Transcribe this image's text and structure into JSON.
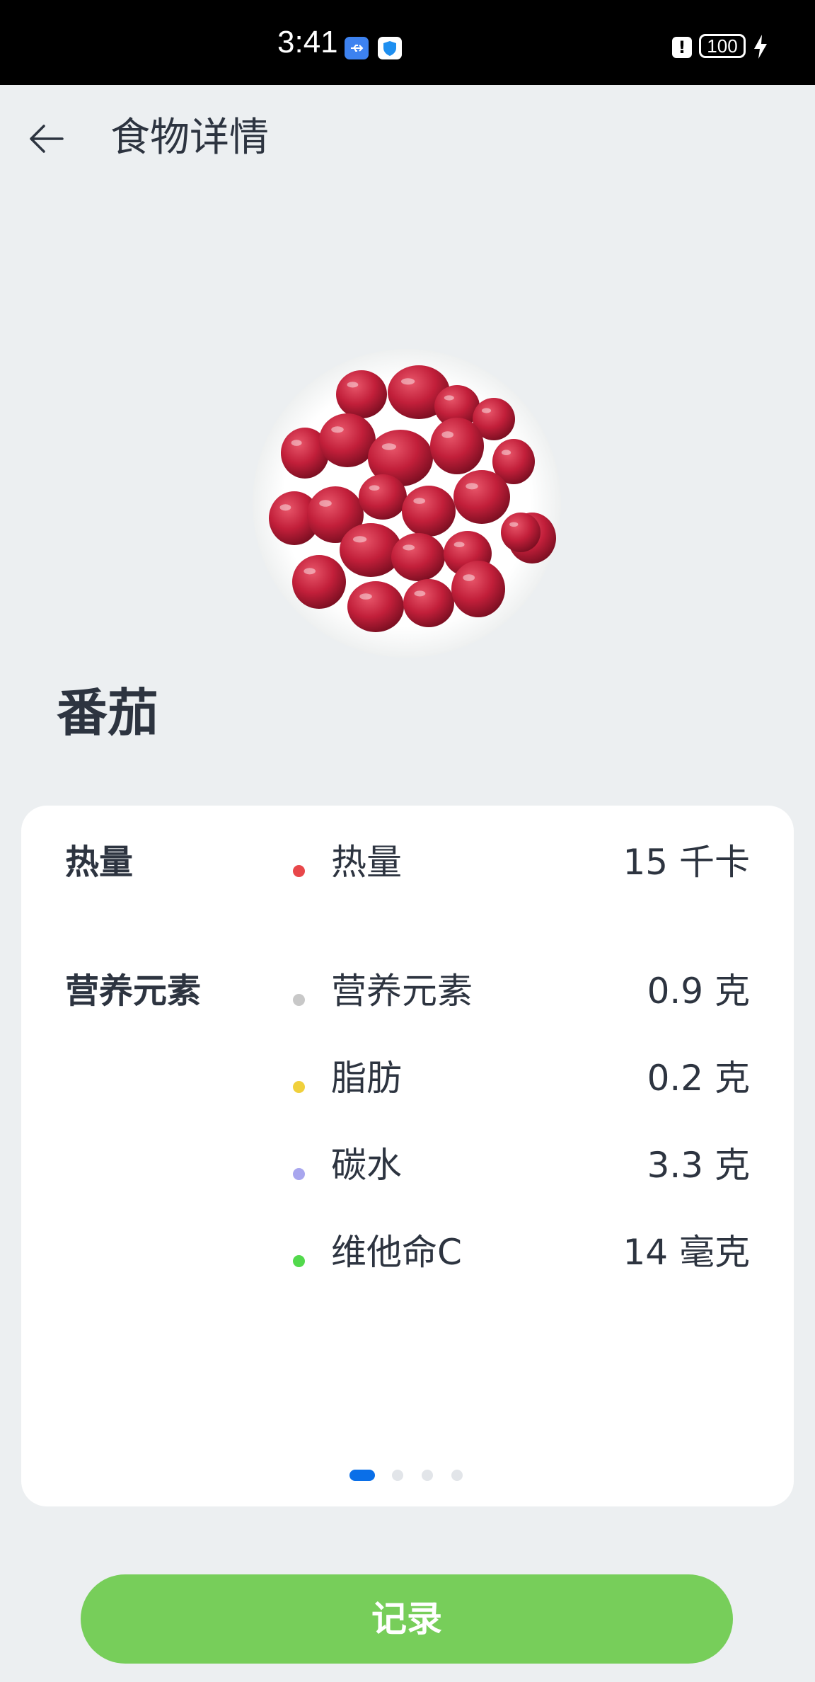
{
  "status_bar": {
    "time": "3:41",
    "battery": "100"
  },
  "header": {
    "title": "食物详情",
    "back_icon": "arrow-left-icon"
  },
  "food": {
    "name": "番茄",
    "photo_icon": "cranberry-bowl-photo"
  },
  "nutrition": {
    "groups": [
      {
        "label": "热量",
        "items": [
          {
            "name": "热量",
            "value": "15 千卡",
            "color": "#e8474a"
          }
        ]
      },
      {
        "label": "营养元素",
        "items": [
          {
            "name": "营养元素",
            "value": "0.9 克",
            "color": "#c8c8c8"
          },
          {
            "name": "脂肪",
            "value": "0.2 克",
            "color": "#f0d03c"
          },
          {
            "name": "碳水",
            "value": "3.3 克",
            "color": "#a8a6ee"
          },
          {
            "name": "维他命C",
            "value": "14 毫克",
            "color": "#52d94c"
          }
        ]
      }
    ],
    "pager": {
      "count": 4,
      "current": 1
    }
  },
  "record_button": {
    "label": "记录",
    "color": "#77ce5a"
  }
}
